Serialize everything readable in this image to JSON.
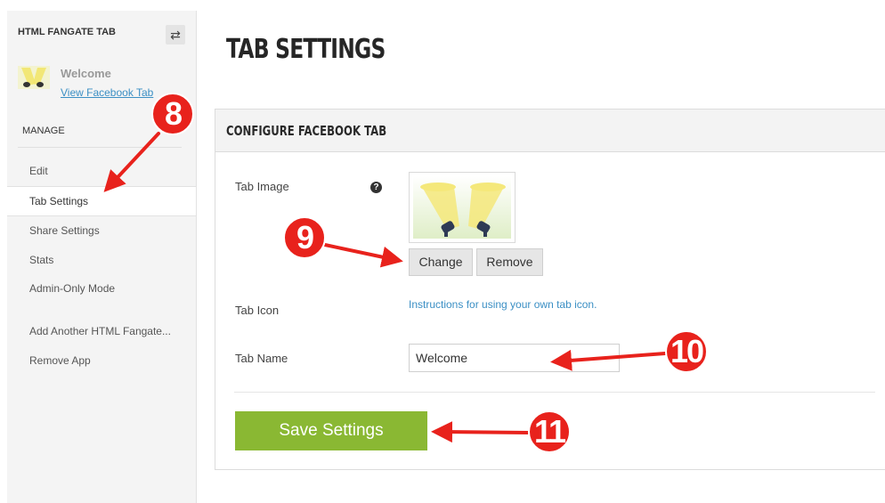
{
  "sidebar": {
    "heading": "HTML FANGATE TAB",
    "swap_icon": "swap-arrows-icon",
    "tab_name": "Welcome",
    "view_link": "View Facebook Tab",
    "manage_label": "MANAGE",
    "items": [
      {
        "label": "Edit"
      },
      {
        "label": "Tab Settings"
      },
      {
        "label": "Share Settings"
      },
      {
        "label": "Stats"
      },
      {
        "label": "Admin-Only Mode"
      },
      {
        "label": "Add Another HTML Fangate..."
      },
      {
        "label": "Remove App"
      }
    ],
    "active_item": "Tab Settings"
  },
  "main": {
    "title": "TAB SETTINGS",
    "panel_title": "CONFIGURE FACEBOOK TAB",
    "tab_image_label": "Tab Image",
    "help_icon": "?",
    "change_label": "Change",
    "remove_label": "Remove",
    "tab_icon_label": "Tab Icon",
    "instructions_link": "Instructions for using your own tab icon.",
    "tab_name_label": "Tab Name",
    "tab_name_value": "Welcome",
    "save_label": "Save Settings"
  },
  "annotations": {
    "step_8": "8",
    "step_9": "9",
    "step_10": "10",
    "step_11": "11"
  },
  "colors": {
    "accent_green": "#8ab833",
    "link_blue": "#3b8fc4",
    "callout_red": "#e8221c"
  }
}
